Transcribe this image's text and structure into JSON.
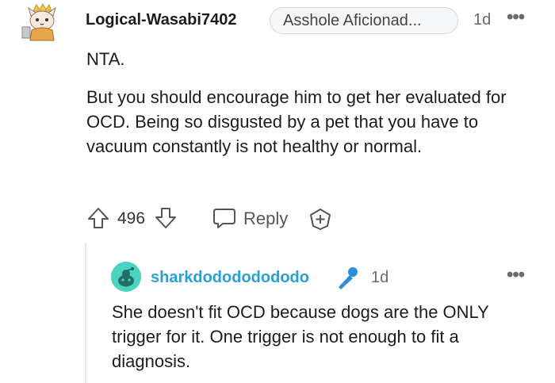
{
  "comment": {
    "username": "Logical-Wasabi7402",
    "flair": "Asshole Aficionad...",
    "time": "1d",
    "more": "•••",
    "paragraphs": [
      "NTA.",
      "But you should encourage him to get her evaluated for OCD. Being so disgusted by a pet that you have to vacuum constantly is not healthy or normal."
    ],
    "score": "496",
    "reply_label": "Reply"
  },
  "reply": {
    "username": "sharkdodododododo",
    "time": "1d",
    "more": "•••",
    "text": "She doesn't fit OCD because dogs are the ONLY trigger for it. One trigger is not enough to fit a diagnosis."
  },
  "icons": {
    "avatar1": "cartoon-cat-king-avatar",
    "upvote": "upvote-arrow-icon",
    "downvote": "downvote-arrow-icon",
    "reply": "speech-bubble-icon",
    "award": "award-plus-icon",
    "avatar2": "reddit-snoo-avatar",
    "mic": "microphone-icon"
  },
  "colors": {
    "username2": "#2a9fd6",
    "avatar2_bg": "#4bd3c2",
    "mic": "#2a8fd6"
  }
}
